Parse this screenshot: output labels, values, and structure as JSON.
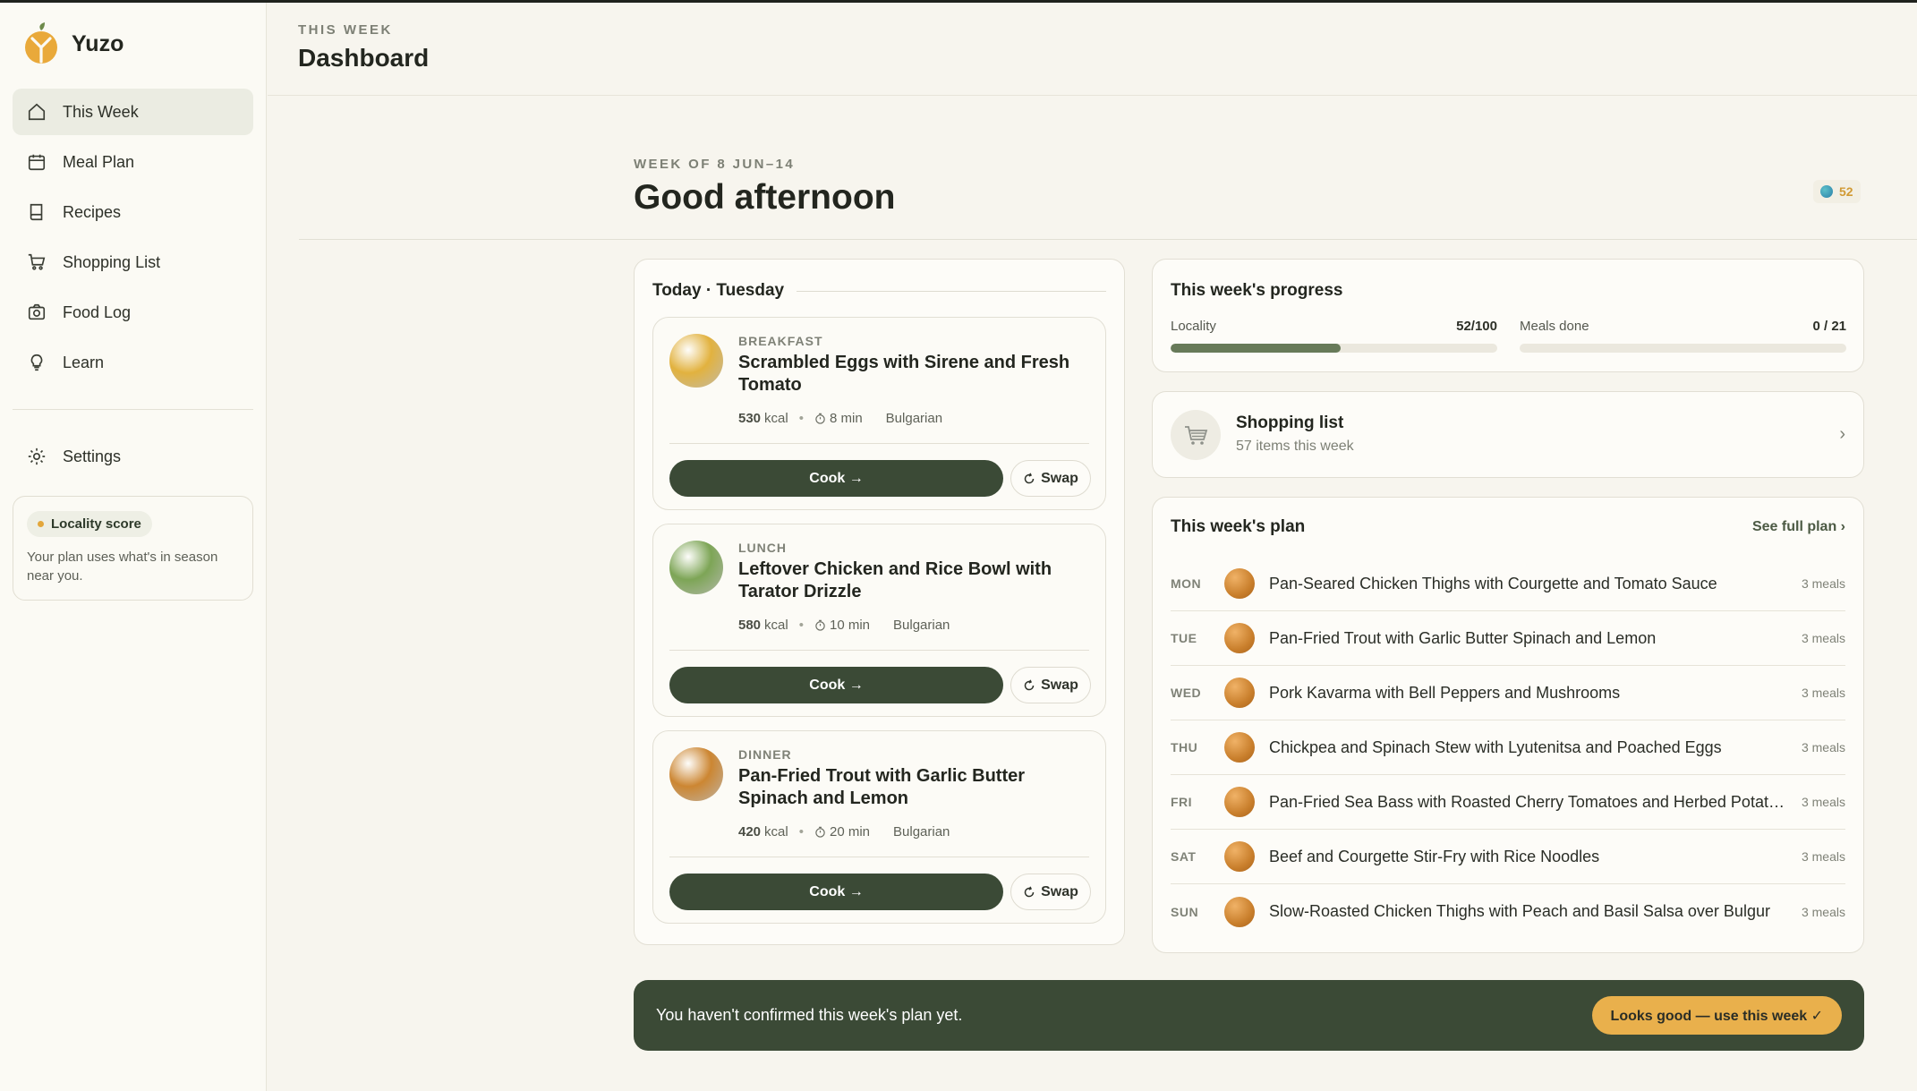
{
  "brand": {
    "name": "Yuzo"
  },
  "sidebar": {
    "items": [
      {
        "label": "This Week",
        "icon": "home-icon",
        "active": true
      },
      {
        "label": "Meal Plan",
        "icon": "calendar-icon"
      },
      {
        "label": "Recipes",
        "icon": "book-icon"
      },
      {
        "label": "Shopping List",
        "icon": "cart-icon"
      },
      {
        "label": "Food Log",
        "icon": "camera-icon"
      },
      {
        "label": "Learn",
        "icon": "lightbulb-icon"
      }
    ],
    "settings": {
      "label": "Settings",
      "icon": "gear-icon"
    },
    "locality": {
      "badge": "Locality score",
      "text": "Your plan uses what's in season near you."
    }
  },
  "header": {
    "eyebrow": "THIS WEEK",
    "title": "Dashboard"
  },
  "greeting": {
    "eyebrow": "WEEK OF 8 JUN–14",
    "title": "Good afternoon",
    "score": "52"
  },
  "today": {
    "title": "Today · Tuesday",
    "meals": [
      {
        "type": "BREAKFAST",
        "name": "Scrambled Eggs with Sirene and Fresh Tomato",
        "kcal": "530",
        "kcal_unit": "kcal",
        "time": "8 min",
        "cuisine": "Bulgarian",
        "color": "#e2b23f"
      },
      {
        "type": "LUNCH",
        "name": "Leftover Chicken and Rice Bowl with Tarator Drizzle",
        "kcal": "580",
        "kcal_unit": "kcal",
        "time": "10 min",
        "cuisine": "Bulgarian",
        "color": "#7da556"
      },
      {
        "type": "DINNER",
        "name": "Pan-Fried Trout with Garlic Butter Spinach and Lemon",
        "kcal": "420",
        "kcal_unit": "kcal",
        "time": "20 min",
        "cuisine": "Bulgarian",
        "color": "#cc8632"
      }
    ],
    "cook_label": "Cook →",
    "swap_label": "Swap"
  },
  "progress": {
    "title": "This week's progress",
    "locality": {
      "label": "Locality",
      "value": "52/100",
      "fraction": 0.52
    },
    "meals": {
      "label": "Meals done",
      "value": "0 / 21",
      "fraction": 0
    }
  },
  "shopping": {
    "title": "Shopping list",
    "subtitle": "57 items this week"
  },
  "plan": {
    "title": "This week's plan",
    "see_all": "See full plan ›",
    "days": [
      {
        "day": "MON",
        "name": "Pan-Seared Chicken Thighs with Courgette and Tomato Sauce",
        "meals": "3 meals"
      },
      {
        "day": "TUE",
        "name": "Pan-Fried Trout with Garlic Butter Spinach and Lemon",
        "meals": "3 meals"
      },
      {
        "day": "WED",
        "name": "Pork Kavarma with Bell Peppers and Mushrooms",
        "meals": "3 meals"
      },
      {
        "day": "THU",
        "name": "Chickpea and Spinach Stew with Lyutenitsa and Poached Eggs",
        "meals": "3 meals"
      },
      {
        "day": "FRI",
        "name": "Pan-Fried Sea Bass with Roasted Cherry Tomatoes and Herbed Potatoes",
        "meals": "3 meals"
      },
      {
        "day": "SAT",
        "name": "Beef and Courgette Stir-Fry with Rice Noodles",
        "meals": "3 meals"
      },
      {
        "day": "SUN",
        "name": "Slow-Roasted Chicken Thighs with Peach and Basil Salsa over Bulgur",
        "meals": "3 meals"
      }
    ]
  },
  "confirm": {
    "message": "You haven't confirmed this week's plan yet.",
    "button": "Looks good — use this week ✓"
  }
}
